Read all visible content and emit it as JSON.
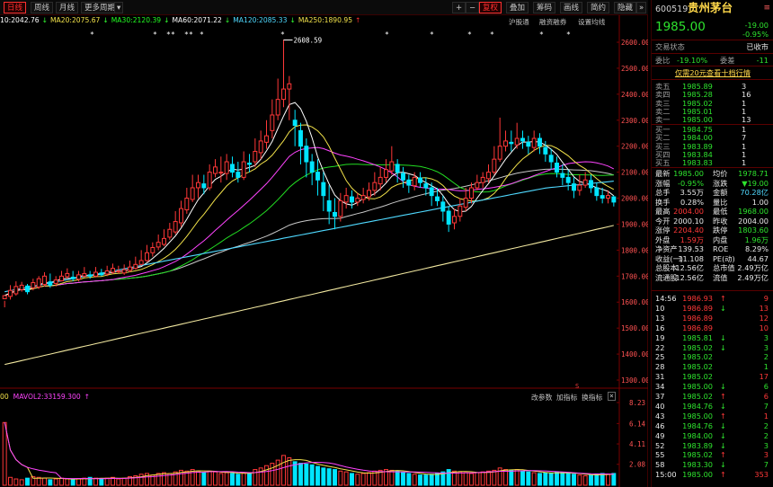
{
  "toolbar": {
    "tabs": [
      "日线",
      "周线",
      "月线",
      "更多周期"
    ],
    "right_buttons": [
      "+",
      "−",
      "复权",
      "叠加",
      "筹码",
      "画线",
      "简约",
      "隐藏"
    ],
    "small_labels": [
      "沪股通",
      "融资融券",
      "设置均线"
    ]
  },
  "ma_line": [
    {
      "text": "10:2042.76",
      "color": "#ffffff"
    },
    {
      "text": "↓",
      "color": "#33ff33"
    },
    {
      "text": "MA20:2075.67",
      "color": "#f2e24a"
    },
    {
      "text": "↓",
      "color": "#33ff33"
    },
    {
      "text": "MA30:2120.39",
      "color": "#22ff22"
    },
    {
      "text": "↓",
      "color": "#33ff33"
    },
    {
      "text": "MA60:2071.22",
      "color": "#ffffff"
    },
    {
      "text": "↓",
      "color": "#33ff33"
    },
    {
      "text": "MA120:2085.33",
      "color": "#4fd9ff"
    },
    {
      "text": "↓",
      "color": "#33ff33"
    },
    {
      "text": "MA250:1890.95",
      "color": "#f2e24a"
    },
    {
      "text": "↑",
      "color": "#ff3030"
    }
  ],
  "price_axis": [
    "2600.00",
    "2500.00",
    "2400.00",
    "2300.00",
    "2200.00",
    "2100.00",
    "2000.00",
    "1900.00",
    "1800.00",
    "1700.00",
    "1600.00",
    "1500.00",
    "1400.00",
    "1300.00"
  ],
  "vol_axis": [
    "8.23",
    "6.14",
    "4.11",
    "2.08"
  ],
  "high_label": "2608.59",
  "vol_header": {
    "left": "00",
    "mavol": "MAVOL2:33159.300",
    "up": "↑"
  },
  "vol_buttons": [
    "改参数",
    "加指标",
    "换指标"
  ],
  "vol_close": "×",
  "vol_marker": "S",
  "stock": {
    "code": "600519",
    "name": "贵州茅台",
    "price": "1985.00",
    "change": "-19.00",
    "pct": "-0.95%"
  },
  "status": {
    "label": "交易状态",
    "value": "已收市"
  },
  "ratio": {
    "wb_label": "委比",
    "wb": "-19.10%",
    "wc_label": "委差",
    "wc": "-11"
  },
  "promo": "仅需20元查看十档行情",
  "sells": [
    {
      "label": "卖五",
      "price": "1985.89",
      "vol": "3"
    },
    {
      "label": "卖四",
      "price": "1985.28",
      "vol": "16"
    },
    {
      "label": "卖三",
      "price": "1985.02",
      "vol": "1"
    },
    {
      "label": "卖二",
      "price": "1985.01",
      "vol": "1"
    },
    {
      "label": "卖一",
      "price": "1985.00",
      "vol": "13"
    }
  ],
  "buys": [
    {
      "label": "买一",
      "price": "1984.75",
      "vol": "1"
    },
    {
      "label": "买二",
      "price": "1984.00",
      "vol": "7"
    },
    {
      "label": "买三",
      "price": "1983.89",
      "vol": "1"
    },
    {
      "label": "买四",
      "price": "1983.84",
      "vol": "1"
    },
    {
      "label": "买五",
      "price": "1983.83",
      "vol": "1"
    }
  ],
  "quotes": [
    [
      {
        "t": "最新",
        "c": "white"
      },
      {
        "t": "1985.00",
        "c": "green"
      },
      {
        "t": "均价",
        "c": "white"
      },
      {
        "t": "1978.71",
        "c": "green"
      }
    ],
    [
      {
        "t": "涨幅",
        "c": "white"
      },
      {
        "t": "-0.95%",
        "c": "green"
      },
      {
        "t": "涨跌",
        "c": "white"
      },
      {
        "t": "▼19.00",
        "c": "green"
      }
    ],
    [
      {
        "t": "总手",
        "c": "white"
      },
      {
        "t": "3.55万",
        "c": "white"
      },
      {
        "t": "金额",
        "c": "white"
      },
      {
        "t": "70.28亿",
        "c": "cyan"
      }
    ],
    [
      {
        "t": "换手",
        "c": "white"
      },
      {
        "t": "0.28%",
        "c": "white"
      },
      {
        "t": "量比",
        "c": "white"
      },
      {
        "t": "1.00",
        "c": "white"
      }
    ],
    [
      {
        "t": "最高",
        "c": "white"
      },
      {
        "t": "2004.00",
        "c": "red"
      },
      {
        "t": "最低",
        "c": "white"
      },
      {
        "t": "1968.00",
        "c": "green"
      }
    ],
    [
      {
        "t": "今开",
        "c": "white"
      },
      {
        "t": "2000.10",
        "c": "white"
      },
      {
        "t": "昨收",
        "c": "white"
      },
      {
        "t": "2004.00",
        "c": "white"
      }
    ],
    [
      {
        "t": "涨停",
        "c": "white"
      },
      {
        "t": "2204.40",
        "c": "red"
      },
      {
        "t": "跌停",
        "c": "white"
      },
      {
        "t": "1803.60",
        "c": "green"
      }
    ],
    [
      {
        "t": "外盘",
        "c": "white"
      },
      {
        "t": "1.59万",
        "c": "red"
      },
      {
        "t": "内盘",
        "c": "white"
      },
      {
        "t": "1.96万",
        "c": "green"
      }
    ],
    [
      {
        "t": "净资产",
        "c": "white"
      },
      {
        "t": "139.53",
        "c": "white"
      },
      {
        "t": "ROE",
        "c": "white"
      },
      {
        "t": "8.29%",
        "c": "white"
      }
    ],
    [
      {
        "t": "收益(一)",
        "c": "white"
      },
      {
        "t": "11.108",
        "c": "white"
      },
      {
        "t": "PE(动)",
        "c": "white"
      },
      {
        "t": "44.67",
        "c": "white"
      }
    ],
    [
      {
        "t": "总股本",
        "c": "white"
      },
      {
        "t": "12.56亿",
        "c": "white"
      },
      {
        "t": "总市值",
        "c": "white"
      },
      {
        "t": "2.49万亿",
        "c": "white"
      }
    ],
    [
      {
        "t": "流通股",
        "c": "white"
      },
      {
        "t": "12.56亿",
        "c": "white"
      },
      {
        "t": "流值",
        "c": "white"
      },
      {
        "t": "2.49万亿",
        "c": "white"
      }
    ]
  ],
  "ticks": [
    {
      "time": "14:56",
      "price": "1986.93",
      "pc": "red",
      "vol": "9",
      "vc": "red",
      "arrow": "↑",
      "ac": "red"
    },
    {
      "time": "10",
      "price": "1986.89",
      "pc": "red",
      "vol": "13",
      "vc": "red",
      "arrow": "↓",
      "ac": "green"
    },
    {
      "time": "13",
      "price": "1986.89",
      "pc": "red",
      "vol": "12",
      "vc": "red",
      "arrow": "",
      "ac": "red"
    },
    {
      "time": "16",
      "price": "1986.89",
      "pc": "red",
      "vol": "10",
      "vc": "red",
      "arrow": "",
      "ac": "red"
    },
    {
      "time": "19",
      "price": "1985.81",
      "pc": "green",
      "vol": "3",
      "vc": "green",
      "arrow": "↓",
      "ac": "green"
    },
    {
      "time": "22",
      "price": "1985.02",
      "pc": "green",
      "vol": "3",
      "vc": "green",
      "arrow": "↓",
      "ac": "green"
    },
    {
      "time": "25",
      "price": "1985.02",
      "pc": "green",
      "vol": "2",
      "vc": "green",
      "arrow": "",
      "ac": "green"
    },
    {
      "time": "28",
      "price": "1985.02",
      "pc": "green",
      "vol": "1",
      "vc": "green",
      "arrow": "",
      "ac": "green"
    },
    {
      "time": "31",
      "price": "1985.02",
      "pc": "green",
      "vol": "17",
      "vc": "red",
      "arrow": "",
      "ac": "red"
    },
    {
      "time": "34",
      "price": "1985.00",
      "pc": "green",
      "vol": "6",
      "vc": "green",
      "arrow": "↓",
      "ac": "green"
    },
    {
      "time": "37",
      "price": "1985.02",
      "pc": "green",
      "vol": "6",
      "vc": "red",
      "arrow": "↑",
      "ac": "red"
    },
    {
      "time": "40",
      "price": "1984.76",
      "pc": "green",
      "vol": "7",
      "vc": "green",
      "arrow": "↓",
      "ac": "green"
    },
    {
      "time": "43",
      "price": "1985.00",
      "pc": "green",
      "vol": "1",
      "vc": "red",
      "arrow": "↑",
      "ac": "red"
    },
    {
      "time": "46",
      "price": "1984.76",
      "pc": "green",
      "vol": "2",
      "vc": "green",
      "arrow": "↓",
      "ac": "green"
    },
    {
      "time": "49",
      "price": "1984.00",
      "pc": "green",
      "vol": "2",
      "vc": "green",
      "arrow": "↓",
      "ac": "green"
    },
    {
      "time": "52",
      "price": "1983.89",
      "pc": "green",
      "vol": "3",
      "vc": "green",
      "arrow": "↓",
      "ac": "green"
    },
    {
      "time": "55",
      "price": "1985.02",
      "pc": "green",
      "vol": "3",
      "vc": "red",
      "arrow": "↑",
      "ac": "red"
    },
    {
      "time": "58",
      "price": "1983.30",
      "pc": "green",
      "vol": "7",
      "vc": "green",
      "arrow": "↓",
      "ac": "green"
    },
    {
      "time": "15:00",
      "price": "1985.00",
      "pc": "green",
      "vol": "353",
      "vc": "red",
      "arrow": "↑",
      "ac": "red"
    }
  ],
  "colors": {
    "up": "#ff3838",
    "down": "#00e5ff",
    "ma5": "#ffffff",
    "ma10": "#f2e24a",
    "ma20": "#ff44ff",
    "ma30": "#22dd22",
    "ma60": "#c8c8c8",
    "ma120": "#4fd9ff",
    "ma250": "#f2e8a0"
  },
  "chart_data": {
    "type": "candlestick",
    "price_axis_range": [
      1300,
      2600
    ],
    "volume_axis_range": [
      0,
      8.23
    ],
    "candles": [
      [
        1613,
        1625,
        1605,
        1580,
        1590,
        700000
      ],
      [
        1622,
        1645,
        1665,
        1610,
        1620,
        10
      ],
      [
        1632,
        1660,
        1680,
        1625,
        1635,
        8
      ],
      [
        1648,
        1665,
        1678,
        1640,
        1650,
        7
      ],
      [
        1662,
        1640,
        1670,
        1630,
        1645,
        9
      ],
      [
        1655,
        1675,
        1690,
        1645,
        1660,
        11
      ],
      [
        1658,
        1690,
        1700,
        1650,
        1675,
        10
      ],
      [
        1668,
        1700,
        1715,
        1660,
        1680,
        9
      ],
      [
        1678,
        1665,
        1710,
        1655,
        1690,
        7
      ],
      [
        1672,
        1685,
        1700,
        1660,
        1690,
        8
      ],
      [
        1682,
        1700,
        1720,
        1680,
        1700,
        9
      ],
      [
        1698,
        1710,
        1730,
        1690,
        1705,
        8
      ],
      [
        1696,
        1690,
        1720,
        1680,
        1700,
        7
      ],
      [
        1688,
        1705,
        1720,
        1680,
        1700,
        8
      ],
      [
        1700,
        1710,
        1735,
        1695,
        1715,
        9
      ],
      [
        1705,
        1700,
        1720,
        1690,
        1708,
        10
      ],
      [
        1700,
        1715,
        1735,
        1695,
        1715,
        9
      ],
      [
        1712,
        1705,
        1728,
        1700,
        1715,
        8
      ],
      [
        1708,
        1720,
        1740,
        1700,
        1720,
        9
      ],
      [
        1715,
        1730,
        1748,
        1708,
        1725,
        10
      ],
      [
        1718,
        1720,
        1740,
        1710,
        1725,
        8
      ],
      [
        1712,
        1725,
        1745,
        1705,
        1720,
        9
      ],
      [
        1722,
        1735,
        1760,
        1715,
        1735,
        11
      ],
      [
        1730,
        1745,
        1775,
        1725,
        1745,
        12
      ],
      [
        1745,
        1760,
        1800,
        1740,
        1765,
        14
      ],
      [
        1760,
        1790,
        1820,
        1755,
        1790,
        15
      ],
      [
        1790,
        1810,
        1830,
        1775,
        1800,
        13
      ],
      [
        1812,
        1830,
        1860,
        1800,
        1840,
        15
      ],
      [
        1822,
        1845,
        1880,
        1815,
        1850,
        16
      ],
      [
        1850,
        1880,
        1905,
        1840,
        1880,
        15
      ],
      [
        1870,
        1910,
        1950,
        1860,
        1900,
        17
      ],
      [
        1905,
        1960,
        1990,
        1890,
        1950,
        19
      ],
      [
        1955,
        2000,
        2040,
        1940,
        1990,
        18
      ],
      [
        1995,
        2040,
        2090,
        1985,
        2040,
        20
      ],
      [
        2040,
        2060,
        2090,
        2000,
        2050,
        18
      ],
      [
        2055,
        2040,
        2090,
        2015,
        2050,
        16
      ],
      [
        2040,
        2100,
        2130,
        2030,
        2080,
        18
      ],
      [
        2095,
        2120,
        2150,
        2080,
        2110,
        17
      ],
      [
        2100,
        2100,
        2160,
        2060,
        2120,
        15
      ],
      [
        2095,
        2140,
        2170,
        2070,
        2130,
        16
      ],
      [
        2130,
        2100,
        2160,
        2080,
        2110,
        15
      ],
      [
        2100,
        2080,
        2140,
        2060,
        2100,
        14
      ],
      [
        2080,
        2140,
        2180,
        2070,
        2130,
        16
      ],
      [
        2135,
        2130,
        2170,
        2100,
        2130,
        15
      ],
      [
        2140,
        2180,
        2230,
        2120,
        2180,
        20
      ],
      [
        2175,
        2220,
        2260,
        2150,
        2200,
        22
      ],
      [
        2215,
        2240,
        2300,
        2190,
        2240,
        25
      ],
      [
        2260,
        2320,
        2380,
        2230,
        2300,
        28
      ],
      [
        2320,
        2380,
        2460,
        2300,
        2390,
        32
      ],
      [
        2380,
        2420,
        2610,
        2350,
        2500,
        38
      ],
      [
        2420,
        2440,
        2470,
        2300,
        2360,
        35
      ],
      [
        2300,
        2280,
        2340,
        2200,
        2260,
        30
      ],
      [
        2260,
        2200,
        2290,
        2130,
        2170,
        28
      ],
      [
        2200,
        2140,
        2230,
        2080,
        2150,
        27
      ],
      [
        2140,
        2100,
        2170,
        2050,
        2110,
        26
      ],
      [
        2100,
        2070,
        2150,
        2010,
        2060,
        24
      ],
      [
        2060,
        2010,
        2100,
        1950,
        2000,
        22
      ],
      [
        1990,
        1950,
        2050,
        1900,
        1980,
        21
      ],
      [
        1945,
        1930,
        2000,
        1880,
        1960,
        20
      ],
      [
        1930,
        1990,
        2020,
        1910,
        1970,
        18
      ],
      [
        1985,
        2010,
        2040,
        1960,
        2000,
        17
      ],
      [
        2005,
        1985,
        2030,
        1960,
        2000,
        15
      ],
      [
        1985,
        2000,
        2020,
        1970,
        1995,
        14
      ],
      [
        1995,
        2010,
        2040,
        1980,
        2010,
        15
      ],
      [
        2005,
        2030,
        2060,
        1990,
        2020,
        16
      ],
      [
        2030,
        2060,
        2100,
        2010,
        2050,
        18
      ],
      [
        2055,
        2080,
        2120,
        2030,
        2070,
        19
      ],
      [
        2080,
        2110,
        2150,
        2060,
        2090,
        20
      ],
      [
        2105,
        2140,
        2200,
        2090,
        2130,
        19
      ],
      [
        2130,
        2100,
        2150,
        2060,
        2110,
        18
      ],
      [
        2095,
        2070,
        2120,
        2040,
        2080,
        16
      ],
      [
        2070,
        2050,
        2090,
        2020,
        2060,
        15
      ],
      [
        2048,
        2080,
        2100,
        2030,
        2070,
        14
      ],
      [
        2078,
        2060,
        2100,
        2040,
        2070,
        13
      ],
      [
        2055,
        2040,
        2080,
        2010,
        2050,
        13
      ],
      [
        2040,
        2010,
        2060,
        1970,
        2030,
        14
      ],
      [
        2005,
        1990,
        2040,
        1970,
        2010,
        15
      ],
      [
        1985,
        1950,
        2010,
        1910,
        1970,
        17
      ],
      [
        1950,
        1900,
        1970,
        1870,
        1920,
        20
      ],
      [
        1905,
        1930,
        1960,
        1880,
        1910,
        18
      ],
      [
        1930,
        1970,
        2000,
        1910,
        1955,
        17
      ],
      [
        1965,
        2000,
        2040,
        1950,
        1990,
        16
      ],
      [
        2000,
        2040,
        2060,
        1980,
        2020,
        15
      ],
      [
        2040,
        2060,
        2090,
        2030,
        2050,
        16
      ],
      [
        2060,
        2080,
        2100,
        2040,
        2080,
        17
      ],
      [
        2075,
        2100,
        2130,
        2060,
        2090,
        18
      ],
      [
        2100,
        2150,
        2200,
        2090,
        2140,
        19
      ],
      [
        2150,
        2200,
        2310,
        2140,
        2200,
        22
      ],
      [
        2200,
        2220,
        2260,
        2180,
        2210,
        20
      ],
      [
        2215,
        2210,
        2260,
        2180,
        2220,
        19
      ],
      [
        2205,
        2230,
        2290,
        2190,
        2240,
        20
      ],
      [
        2230,
        2220,
        2260,
        2190,
        2220,
        18
      ],
      [
        2215,
        2200,
        2240,
        2170,
        2200,
        17
      ],
      [
        2195,
        2230,
        2260,
        2180,
        2215,
        16
      ],
      [
        2230,
        2200,
        2250,
        2170,
        2210,
        15
      ],
      [
        2195,
        2170,
        2220,
        2140,
        2180,
        16
      ],
      [
        2165,
        2140,
        2190,
        2110,
        2150,
        15
      ],
      [
        2135,
        2100,
        2160,
        2080,
        2120,
        17
      ],
      [
        2095,
        2080,
        2130,
        2050,
        2090,
        16
      ],
      [
        2080,
        2060,
        2110,
        2030,
        2070,
        15
      ],
      [
        2055,
        2030,
        2080,
        2000,
        2040,
        14
      ],
      [
        2030,
        2050,
        2090,
        2010,
        2040,
        13
      ],
      [
        2050,
        2070,
        2100,
        2040,
        2065,
        12
      ],
      [
        2068,
        2040,
        2090,
        2020,
        2050,
        13
      ],
      [
        2040,
        2010,
        2060,
        1990,
        2020,
        14
      ],
      [
        2010,
        2000,
        2040,
        1980,
        2005,
        15
      ],
      [
        2000,
        2010,
        2030,
        1980,
        2000,
        14
      ],
      [
        2005,
        1985,
        2010,
        1968,
        1990,
        15
      ]
    ]
  }
}
